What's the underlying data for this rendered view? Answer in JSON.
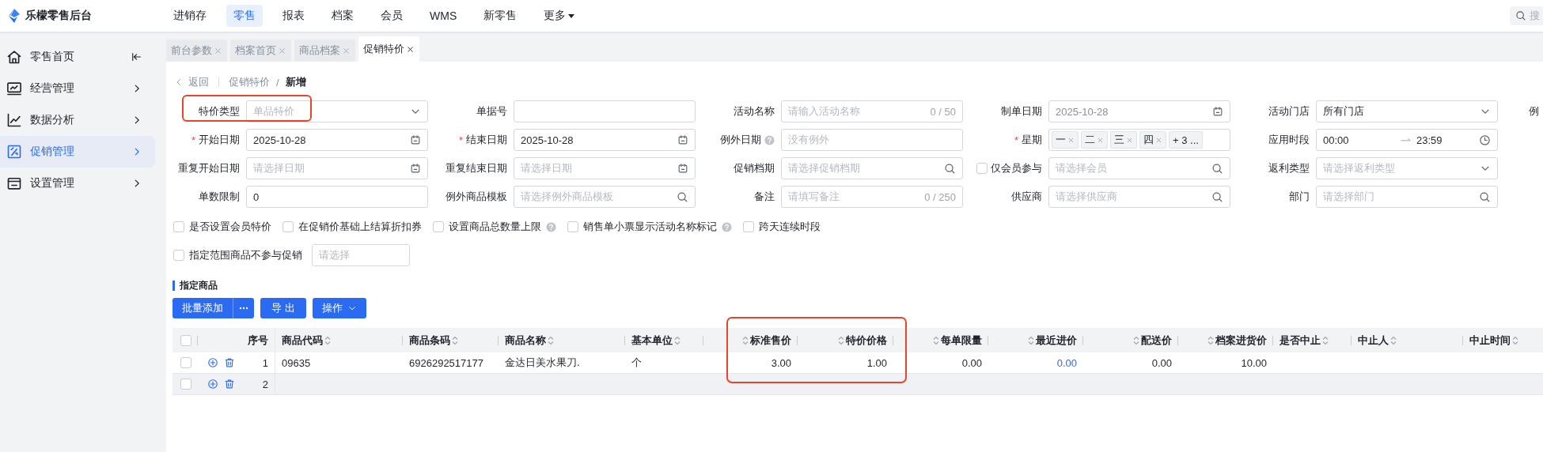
{
  "app": {
    "title": "乐檬零售后台"
  },
  "nav": [
    {
      "label": "进销存",
      "selected": false,
      "dropdown": false
    },
    {
      "label": "零售",
      "selected": true,
      "dropdown": false
    },
    {
      "label": "报表",
      "selected": false,
      "dropdown": false
    },
    {
      "label": "档案",
      "selected": false,
      "dropdown": false
    },
    {
      "label": "会员",
      "selected": false,
      "dropdown": false
    },
    {
      "label": "WMS",
      "selected": false,
      "dropdown": false
    },
    {
      "label": "新零售",
      "selected": false,
      "dropdown": false
    },
    {
      "label": "更多",
      "selected": false,
      "dropdown": true
    }
  ],
  "search": {
    "placeholder": "搜"
  },
  "sidebar": {
    "items": [
      {
        "label": "零售首页",
        "selected": false
      },
      {
        "label": "经营管理",
        "selected": false
      },
      {
        "label": "数据分析",
        "selected": false
      },
      {
        "label": "促销管理",
        "selected": true
      },
      {
        "label": "设置管理",
        "selected": false
      }
    ]
  },
  "tabs": [
    {
      "label": "前台参数",
      "selected": false
    },
    {
      "label": "档案首页",
      "selected": false
    },
    {
      "label": "商品档案",
      "selected": false
    },
    {
      "label": "促销特价",
      "selected": true
    }
  ],
  "breadcrumb": {
    "back": "返回",
    "items": [
      {
        "label": "促销特价",
        "current": false
      },
      {
        "label": "新增",
        "current": true
      }
    ],
    "separator": "/"
  },
  "form": {
    "rows": [
      [
        {
          "label": "特价类型",
          "kind": "select",
          "placeholder": "单品特价",
          "highlighted": true
        },
        {
          "label": "单据号",
          "kind": "text",
          "highlighted": false
        },
        {
          "label": "活动名称",
          "kind": "text",
          "placeholder": "请输入活动名称",
          "counter": "0 / 50",
          "highlighted": false
        },
        {
          "label": "制单日期",
          "kind": "date",
          "value": "2025-10-28",
          "disabled": true,
          "highlighted": false
        },
        {
          "label": "活动门店",
          "kind": "select",
          "value": "所有门店",
          "highlighted": false
        },
        {
          "label": "例",
          "kind": "cut"
        }
      ],
      [
        {
          "label": "开始日期",
          "kind": "date",
          "value": "2025-10-28",
          "required_mark": "*",
          "highlighted": false
        },
        {
          "label": "结束日期",
          "kind": "date",
          "value": "2025-10-28",
          "required_mark": "*",
          "highlighted": false
        },
        {
          "label": "例外日期",
          "kind": "text",
          "placeholder": "没有例外",
          "help": true,
          "highlighted": false
        },
        {
          "label": "星期",
          "kind": "tags",
          "tags": [
            "一",
            "二",
            "三",
            "四"
          ],
          "more": "+ 3 ...",
          "required_mark": "*",
          "highlighted": false
        },
        {
          "label": "应用时段",
          "kind": "timerange",
          "start": "00:00",
          "end": "23:59",
          "highlighted": false
        }
      ],
      [
        {
          "label": "重复开始日期",
          "kind": "date",
          "placeholder": "请选择日期",
          "highlighted": false
        },
        {
          "label": "重复结束日期",
          "kind": "date",
          "placeholder": "请选择日期",
          "highlighted": false
        },
        {
          "label": "促销档期",
          "kind": "search",
          "placeholder": "请选择促销档期",
          "highlighted": false
        },
        {
          "label": "仅会员参与",
          "kind": "search",
          "placeholder": "请选择会员",
          "checked": false,
          "highlighted": false
        },
        {
          "label": "返利类型",
          "kind": "select",
          "placeholder": "请选择返利类型",
          "highlighted": false
        }
      ],
      [
        {
          "label": "单数限制",
          "kind": "text",
          "value": "0",
          "highlighted": false
        },
        {
          "label": "例外商品模板",
          "kind": "search",
          "placeholder": "请选择例外商品模板",
          "highlighted": false
        },
        {
          "label": "备注",
          "kind": "text",
          "placeholder": "请填写备注",
          "counter": "0 / 250",
          "highlighted": false
        },
        {
          "label": "供应商",
          "kind": "search",
          "placeholder": "请选择供应商",
          "highlighted": false
        },
        {
          "label": "部门",
          "kind": "search",
          "placeholder": "请选择部门",
          "highlighted": false
        }
      ]
    ],
    "options": [
      {
        "label": "是否设置会员特价",
        "checked": false,
        "help": false
      },
      {
        "label": "在促销价基础上结算折扣券",
        "checked": false,
        "help": false
      },
      {
        "label": "设置商品总数量上限",
        "checked": false,
        "help": true
      },
      {
        "label": "销售单小票显示活动名称标记",
        "checked": false,
        "help": true
      },
      {
        "label": "跨天连续时段",
        "checked": false,
        "help": false
      }
    ],
    "scope": {
      "label": "指定范围商品不参与促销",
      "checked": false,
      "placeholder": "请选择"
    }
  },
  "section": {
    "title": "指定商品"
  },
  "toolbar": [
    {
      "label": "批量添加",
      "kind": "split"
    },
    {
      "label": "导 出",
      "kind": "plain"
    },
    {
      "label": "操作",
      "kind": "dropdown"
    }
  ],
  "table": {
    "header_checked": false,
    "seq_label": "序号",
    "columns": [
      {
        "label": "商品代码",
        "kind": "text",
        "highlighted": false
      },
      {
        "label": "商品条码",
        "kind": "text",
        "highlighted": false
      },
      {
        "label": "商品名称",
        "kind": "text",
        "highlighted": false
      },
      {
        "label": "基本单位",
        "kind": "text",
        "highlighted": false
      },
      {
        "label": "标准售价",
        "kind": "number",
        "highlighted": true
      },
      {
        "label": "特价价格",
        "kind": "number",
        "highlighted": true
      },
      {
        "label": "每单限量",
        "kind": "number",
        "highlighted": false
      },
      {
        "label": "最近进价",
        "kind": "link",
        "highlighted": false
      },
      {
        "label": "配送价",
        "kind": "number",
        "highlighted": false
      },
      {
        "label": "档案进货价",
        "kind": "number",
        "highlighted": false
      },
      {
        "label": "是否中止",
        "kind": "flag",
        "highlighted": false
      },
      {
        "label": "中止人",
        "kind": "flag",
        "highlighted": false
      },
      {
        "label": "中止时间",
        "kind": "flag",
        "highlighted": false
      }
    ],
    "rows": [
      {
        "checked": false,
        "hovered": false,
        "seq": "1",
        "cells": [
          "09635",
          "6926292517177",
          "金达日美水果刀.",
          "个",
          "3.00",
          "1.00",
          "0.00",
          "0.00",
          "0.00",
          "10.00"
        ]
      },
      {
        "checked": false,
        "hovered": true,
        "seq": "2",
        "cells": []
      }
    ]
  }
}
